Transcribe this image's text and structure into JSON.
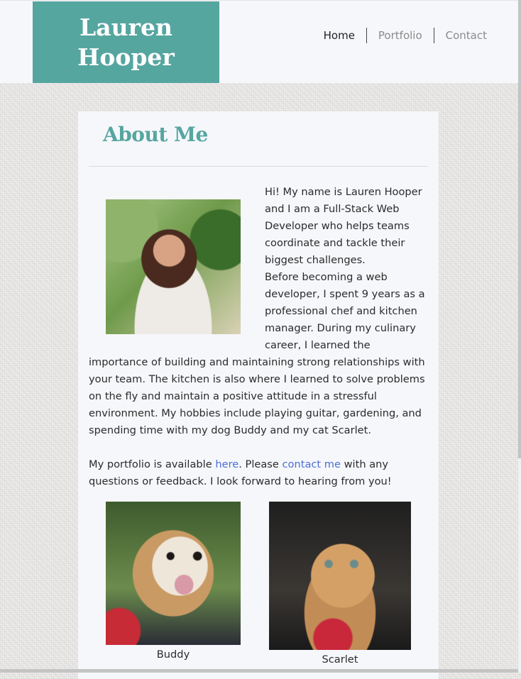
{
  "header": {
    "logo_line1": "Lauren",
    "logo_line2": "Hooper",
    "nav": [
      {
        "label": "Home",
        "active": true
      },
      {
        "label": "Portfolio",
        "active": false
      },
      {
        "label": "Contact",
        "active": false
      }
    ]
  },
  "about": {
    "heading": "About Me",
    "portrait_alt": "Photo of Lauren Hooper",
    "para1": "Hi! My name is Lauren Hooper and I am a Full-Stack Web Developer who helps teams coordinate and tackle their biggest challenges.",
    "para2": "Before becoming a web developer, I spent 9 years as a professional chef and kitchen manager. During my culinary career, I learned the importance of building and maintaining strong relationships with your team. The kitchen is also where I learned to solve problems on the fly and maintain a positive attitude in a stressful environment. My hobbies include playing guitar, gardening, and spending time with my dog Buddy and my cat Scarlet.",
    "para3_before": "My portfolio is available ",
    "para3_link1": "here",
    "para3_middle": ". Please ",
    "para3_link2": "contact me",
    "para3_after": " with any questions or feedback. I look forward to hearing from you!"
  },
  "pets": [
    {
      "caption": "Buddy"
    },
    {
      "caption": "Scarlet"
    }
  ],
  "colors": {
    "accent": "#56a6a0",
    "link": "#4a6fd6",
    "card_bg": "#f6f7fb"
  }
}
